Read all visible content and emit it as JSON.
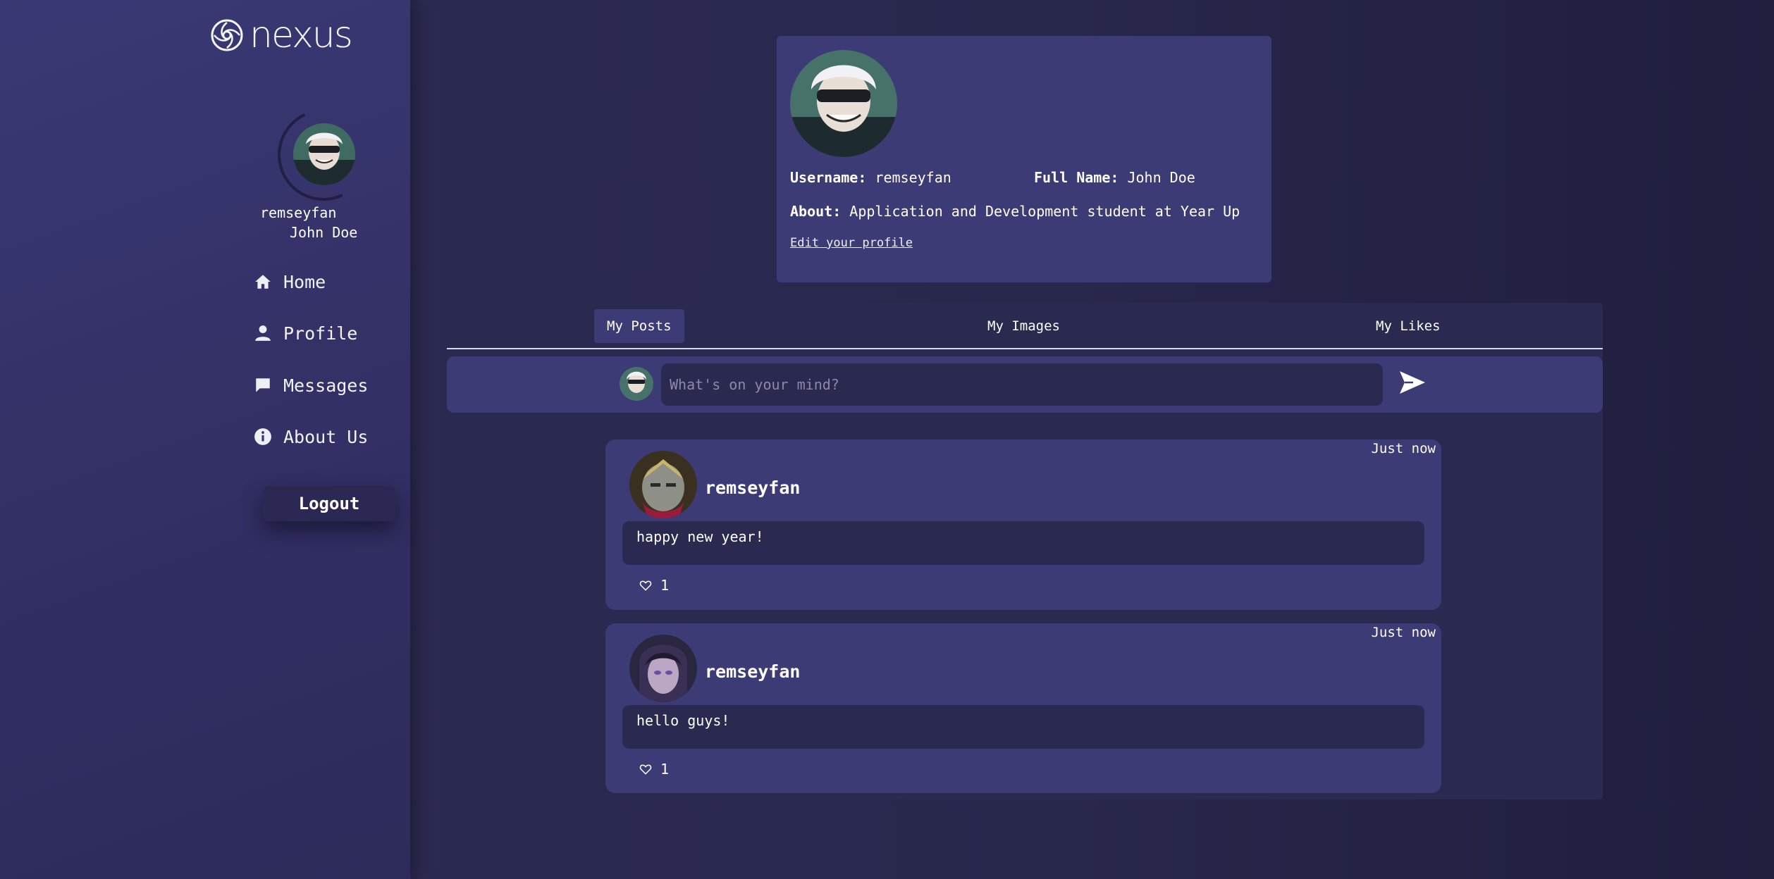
{
  "brand": {
    "name": "nexus"
  },
  "sidebar": {
    "username": "remseyfan",
    "full_name": "John Doe",
    "nav": [
      {
        "label": "Home",
        "icon": "home-icon"
      },
      {
        "label": "Profile",
        "icon": "user-icon"
      },
      {
        "label": "Messages",
        "icon": "chat-icon"
      },
      {
        "label": "About Us",
        "icon": "info-icon"
      }
    ],
    "logout_label": "Logout"
  },
  "profile": {
    "username_label": "Username:",
    "username": "remseyfan",
    "fullname_label": "Full Name:",
    "full_name": "John Doe",
    "about_label": "About:",
    "about": "Application and Development student at Year Up",
    "edit_link": "Edit your profile"
  },
  "tabs": [
    {
      "label": "My Posts",
      "active": true
    },
    {
      "label": "My Images",
      "active": false
    },
    {
      "label": "My Likes",
      "active": false
    }
  ],
  "composer": {
    "placeholder": "What's on your mind?"
  },
  "posts": [
    {
      "time": "Just now",
      "username": "remseyfan",
      "text": "happy new year!",
      "likes": "1"
    },
    {
      "time": "Just now",
      "username": "remseyfan",
      "text": "hello guys!",
      "likes": "1"
    }
  ],
  "colors": {
    "sidebar_bg": "#3b3975",
    "page_bg": "#2c2b54",
    "card_bg": "#3d3b75",
    "input_bg": "#2a2950"
  }
}
